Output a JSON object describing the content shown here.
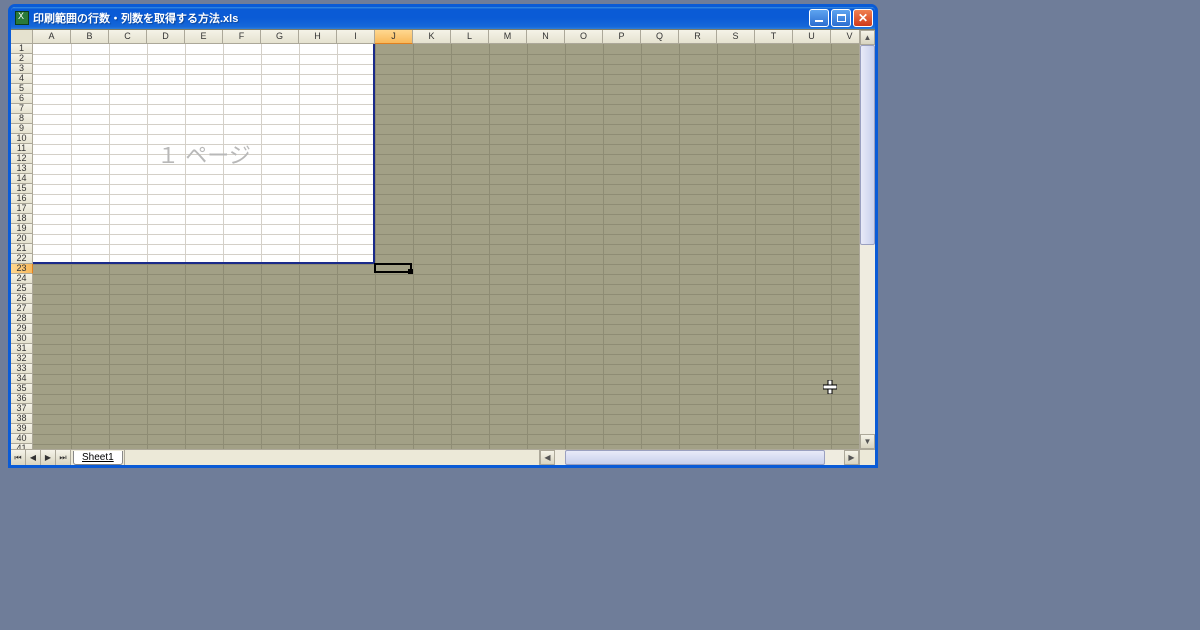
{
  "window": {
    "title": "印刷範囲の行数・列数を取得する方法.xls"
  },
  "columns": [
    "A",
    "B",
    "C",
    "D",
    "E",
    "F",
    "G",
    "H",
    "I",
    "J",
    "K",
    "L",
    "M",
    "N",
    "O",
    "P",
    "Q",
    "R",
    "S",
    "T",
    "U",
    "V"
  ],
  "selected_col": "J",
  "selected_row": "23",
  "row_count": 42,
  "print": {
    "watermark": "１ ページ",
    "last_col_index": 9,
    "last_row": 22
  },
  "tabs": {
    "sheet1": "Sheet1"
  },
  "nav": {
    "first": "⏮",
    "prev": "◀",
    "next": "▶",
    "last": "⏭"
  },
  "scroll": {
    "up": "▲",
    "down": "▼",
    "left": "◀",
    "right": "▶"
  }
}
